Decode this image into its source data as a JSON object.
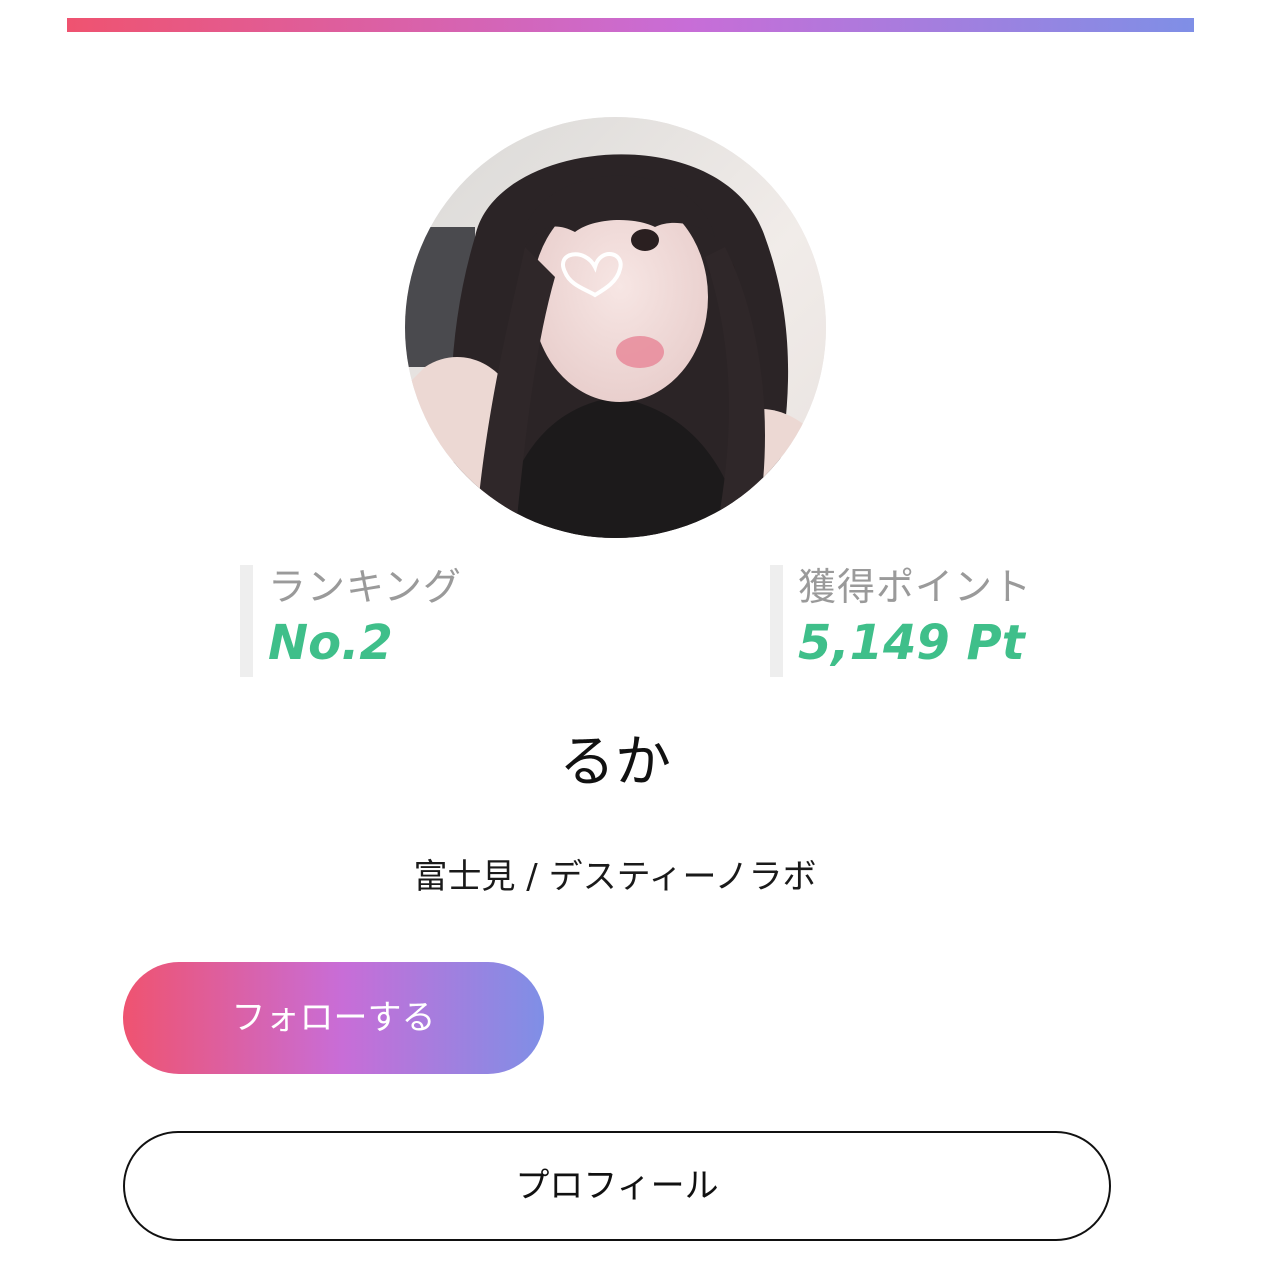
{
  "header": {
    "accent_gradient": [
      "#ef5370",
      "#c86dd7",
      "#7f8fe6"
    ]
  },
  "profile": {
    "avatar_icon": "avatar-photo",
    "name": "るか",
    "shop": "富士見 / デスティーノラボ"
  },
  "stats": {
    "ranking_label": "ランキング",
    "ranking_value": "No.2",
    "points_label": "獲得ポイント",
    "points_value": "5,149 Pt",
    "value_color": "#3fbf8a"
  },
  "actions": {
    "follow_label": "フォローする",
    "profile_label": "プロフィール"
  }
}
